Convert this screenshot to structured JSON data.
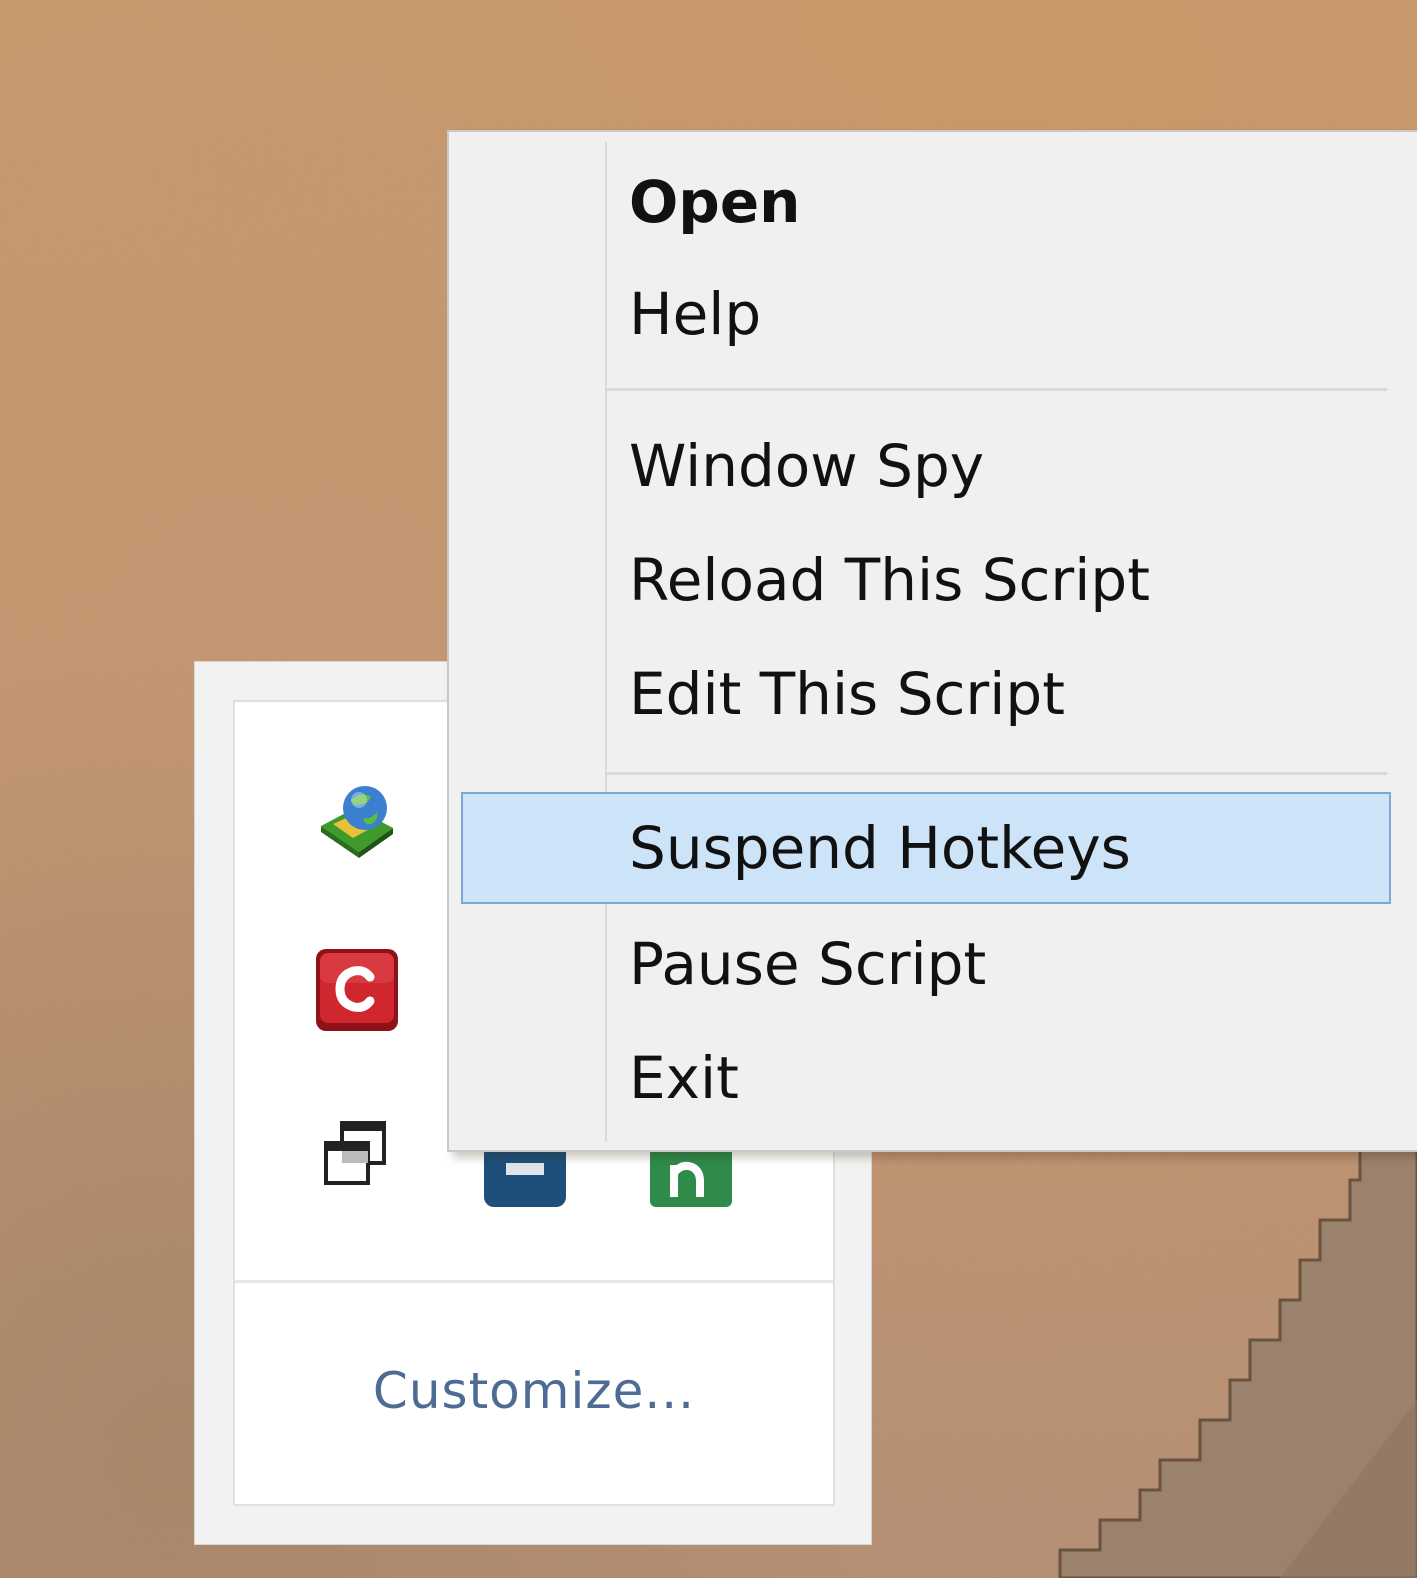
{
  "context_menu": {
    "items": [
      {
        "label": "Open",
        "default": true
      },
      {
        "label": "Help"
      },
      {
        "label": "Window Spy"
      },
      {
        "label": "Reload This Script"
      },
      {
        "label": "Edit This Script"
      },
      {
        "label": "Suspend Hotkeys",
        "highlighted": true
      },
      {
        "label": "Pause Script"
      },
      {
        "label": "Exit"
      }
    ],
    "highlight_color": "#cde3f7",
    "highlight_border_color": "#7ca6d6"
  },
  "tray_flyout": {
    "icons": [
      {
        "name": "download-manager-globe-icon"
      },
      {
        "name": "red-c-app-icon",
        "color": "#c0202a"
      },
      {
        "name": "windows-overlap-icon"
      },
      {
        "name": "blue-app-icon",
        "color": "#1d4f7a"
      },
      {
        "name": "green-app-icon",
        "color": "#2e8b4a"
      }
    ],
    "customize_label": "Customize...",
    "link_color": "#4d6b93"
  }
}
